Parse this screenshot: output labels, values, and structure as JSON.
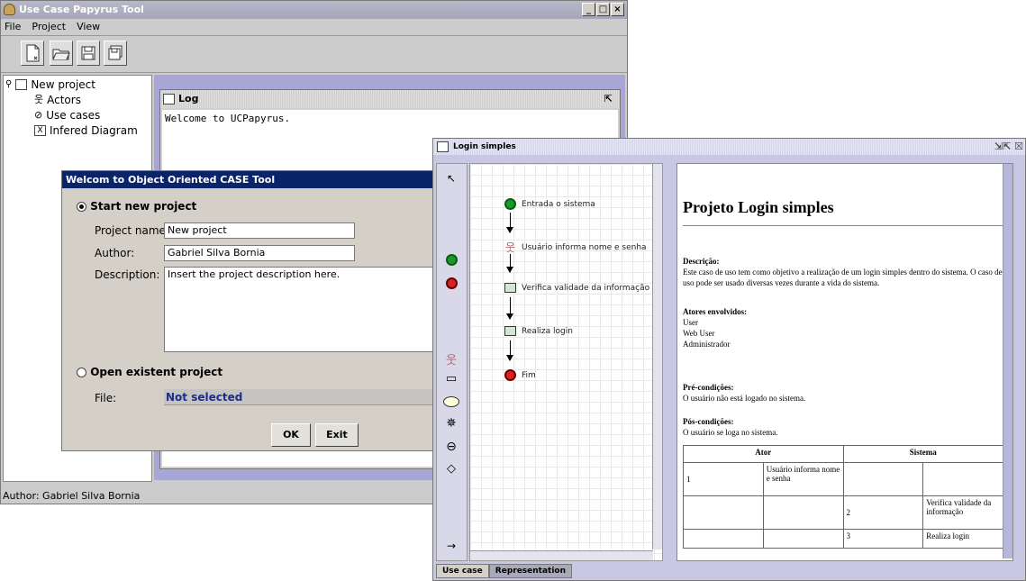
{
  "main_window": {
    "title": "Use Case Papyrus Tool",
    "menu": [
      "File",
      "Project",
      "View"
    ],
    "tree": {
      "root": "New project",
      "items": [
        "Actors",
        "Use cases",
        "Infered Diagram"
      ]
    },
    "status": "Author: Gabriel Silva Bornia",
    "log": {
      "title": "Log",
      "text": "Welcome to UCPapyrus."
    }
  },
  "dialog": {
    "title": "Welcom to Object Oriented CASE Tool",
    "start_new_label": "Start new project",
    "project_name_label": "Project name:",
    "project_name_value": "New project",
    "author_label": "Author:",
    "author_value": "Gabriel Silva Bornia",
    "description_label": "Description:",
    "description_value": "Insert the project description here.",
    "open_existent_label": "Open existent project",
    "file_label": "File:",
    "file_value": "Not selected",
    "ok_label": "OK",
    "exit_label": "Exit"
  },
  "login_window": {
    "title": "Login simples",
    "diagram_nodes": [
      "Entrada o sistema",
      "Usuário informa nome e senha",
      "Verifica validade da informação",
      "Realiza login",
      "Fim"
    ],
    "tabs": [
      "Use case",
      "Representation"
    ],
    "doc": {
      "heading": "Projeto Login simples",
      "descricao_label": "Descrição:",
      "descricao_text": "Este caso de uso tem como objetivo a realização de um login simples dentro do sistema. O caso de uso pode ser usado diversas vezes durante a vida do sistema.",
      "atores_label": "Atores envolvidos:",
      "atores": [
        "User",
        "Web User",
        "Administrador"
      ],
      "pre_label": "Pré-condições:",
      "pre_text": "O usuário não está logado no sistema.",
      "pos_label": "Pós-condições:",
      "pos_text": "O usuário se loga no sistema.",
      "table_headers": [
        "Ator",
        "Sistema"
      ],
      "table_rows": [
        [
          "1",
          "Usuário informa nome e senha",
          "",
          ""
        ],
        [
          "",
          "",
          "2",
          "Verifica validade da informação"
        ],
        [
          "",
          "",
          "3",
          "Realiza login"
        ]
      ]
    }
  }
}
